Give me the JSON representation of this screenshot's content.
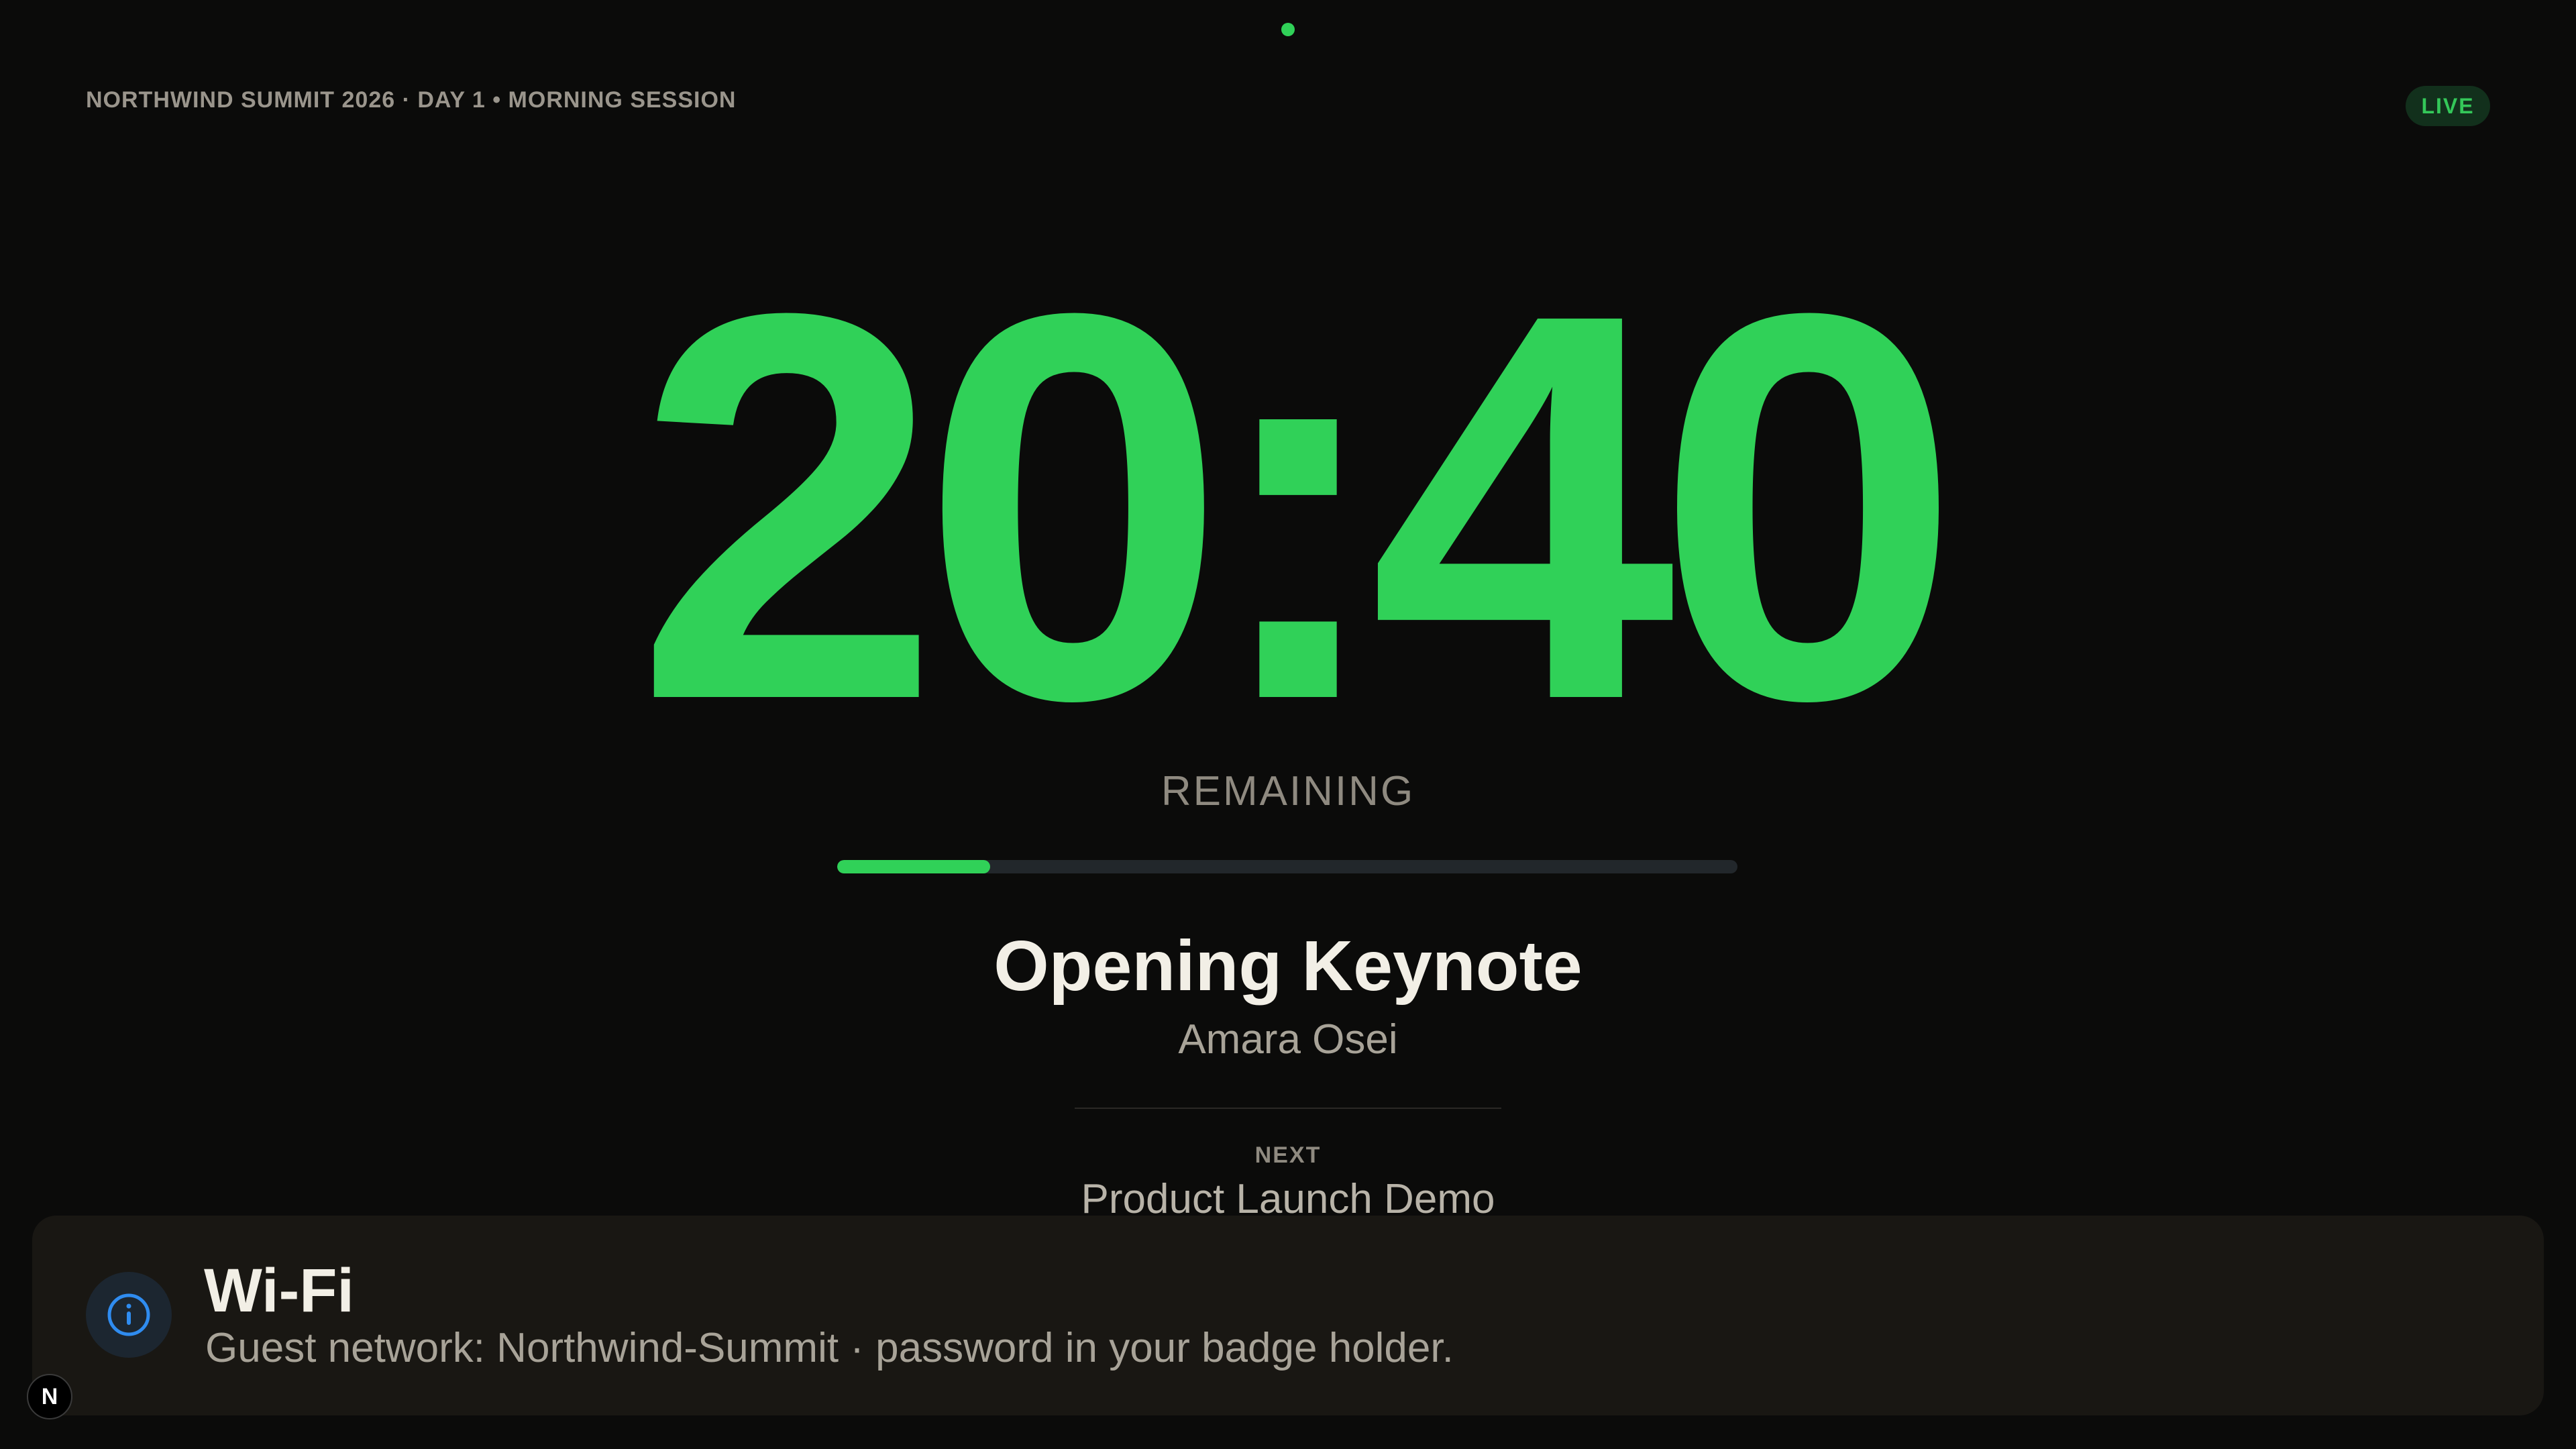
{
  "header": {
    "event_label": "NORTHWIND SUMMIT 2026 · DAY 1 • MORNING SESSION",
    "live_badge": "LIVE"
  },
  "timer": {
    "display": "20:40",
    "label": "REMAINING",
    "progress_fraction": 0.17
  },
  "session": {
    "title": "Opening Keynote",
    "speaker": "Amara Osei"
  },
  "next": {
    "label": "NEXT",
    "title": "Product Launch Demo"
  },
  "notification": {
    "icon": "info-icon",
    "title": "Wi-Fi",
    "message": "Guest network: Northwind-Summit · password in your badge holder."
  },
  "corner_logo": {
    "icon": "n-logo-icon",
    "glyph": "N"
  },
  "colors": {
    "background": "#0b0b0a",
    "accent_green": "#30d158",
    "live_text": "#34c759",
    "info_blue": "#2f8cf0"
  }
}
